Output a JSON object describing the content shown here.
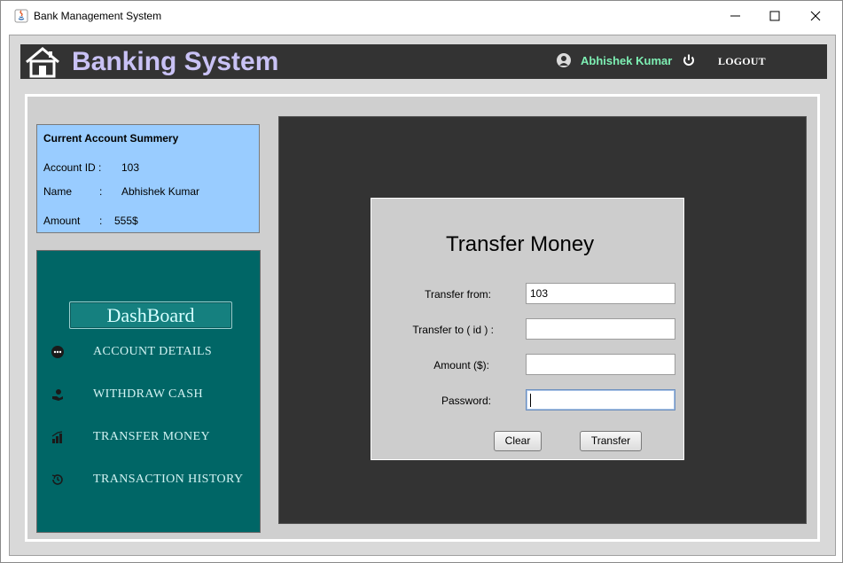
{
  "window": {
    "title": "Bank Management System",
    "minimize_icon": "minimize-icon",
    "maximize_icon": "maximize-icon",
    "close_icon": "close-icon"
  },
  "header": {
    "logo_icon": "bank-house-icon",
    "title": "Banking System",
    "user_icon": "user-icon",
    "user_name": "Abhishek Kumar",
    "power_icon": "power-icon",
    "logout_label": "LOGOUT"
  },
  "summary": {
    "title": "Current Account Summery",
    "account_id_label": "Account ID :",
    "account_id_value": "103",
    "name_label": "Name",
    "name_colon": ":",
    "name_value": "Abhishek Kumar",
    "amount_label": "Amount",
    "amount_colon": ":",
    "amount_value": "555$"
  },
  "sidebar": {
    "dashboard_label": "DashBoard",
    "items": [
      {
        "label": "ACCOUNT DETAILS",
        "icon": "more-dots-icon"
      },
      {
        "label": "WITHDRAW CASH",
        "icon": "cash-hand-icon"
      },
      {
        "label": "TRANSFER MONEY",
        "icon": "bar-chart-icon"
      },
      {
        "label": "TRANSACTION HISTORY",
        "icon": "history-icon"
      }
    ]
  },
  "transfer_form": {
    "title": "Transfer Money",
    "from_label": "Transfer from:",
    "from_value": "103",
    "to_label": "Transfer to ( id ) :",
    "to_value": "",
    "amount_label": "Amount ($):",
    "amount_value": "",
    "password_label": "Password:",
    "password_value": "",
    "clear_label": "Clear",
    "transfer_label": "Transfer"
  },
  "colors": {
    "header_bg": "#333333",
    "title_color": "#c9c2f5",
    "user_name_color": "#7ef0b4",
    "summary_bg": "#99ccff",
    "sidebar_bg": "#006666",
    "main_panel_bg": "#333333",
    "form_bg": "#cdcdcd"
  }
}
